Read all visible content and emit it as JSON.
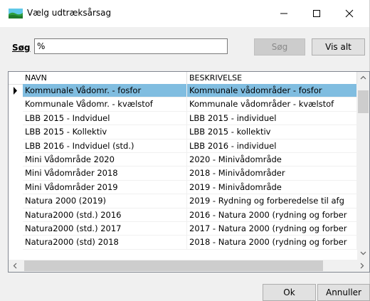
{
  "window": {
    "title": "Vælg udtræksårsag"
  },
  "search": {
    "label": "Søg",
    "value": "%",
    "search_button": "Søg",
    "show_all_button": "Vis alt"
  },
  "grid": {
    "columns": [
      "NAVN",
      "BESKRIVELSE"
    ],
    "selected_index": 0,
    "rows": [
      {
        "name": "Kommunale Vådomr. - fosfor",
        "desc": "Kommunale vådområder - fosfor"
      },
      {
        "name": "Kommunale Vådomr. - kvælstof",
        "desc": "Kommunale vådområder - kvælstof"
      },
      {
        "name": "LBB 2015 - Indviduel",
        "desc": "LBB 2015 - individuel"
      },
      {
        "name": "LBB 2015 - Kollektiv",
        "desc": "LBB 2015 - kollektiv"
      },
      {
        "name": "LBB 2016 - Indviduel (std.)",
        "desc": "LBB 2016 - individuel"
      },
      {
        "name": "Mini Vådområde 2020",
        "desc": "2020 - Minivådområde"
      },
      {
        "name": "Mini Vådområder 2018",
        "desc": "2018 - Minivådområder"
      },
      {
        "name": "Mini Vådområder 2019",
        "desc": "2019 - Minivådområde"
      },
      {
        "name": "Natura 2000 (2019)",
        "desc": "2019 - Rydning og forberedelse til afg"
      },
      {
        "name": "Natura2000 (std.) 2016",
        "desc": "2016 - Natura 2000 (rydning og forber"
      },
      {
        "name": "Natura2000 (std.) 2017",
        "desc": "2017 - Natura 2000 (rydning og forber"
      },
      {
        "name": "Natura2000 (std) 2018",
        "desc": "2018 - Natura 2000 (rydning og forber"
      }
    ]
  },
  "footer": {
    "ok_button": "Ok",
    "cancel_button": "Annuller"
  },
  "icons": {
    "app": "landscape-icon",
    "minimize": "minimize-icon",
    "maximize": "maximize-icon",
    "close": "close-icon"
  }
}
